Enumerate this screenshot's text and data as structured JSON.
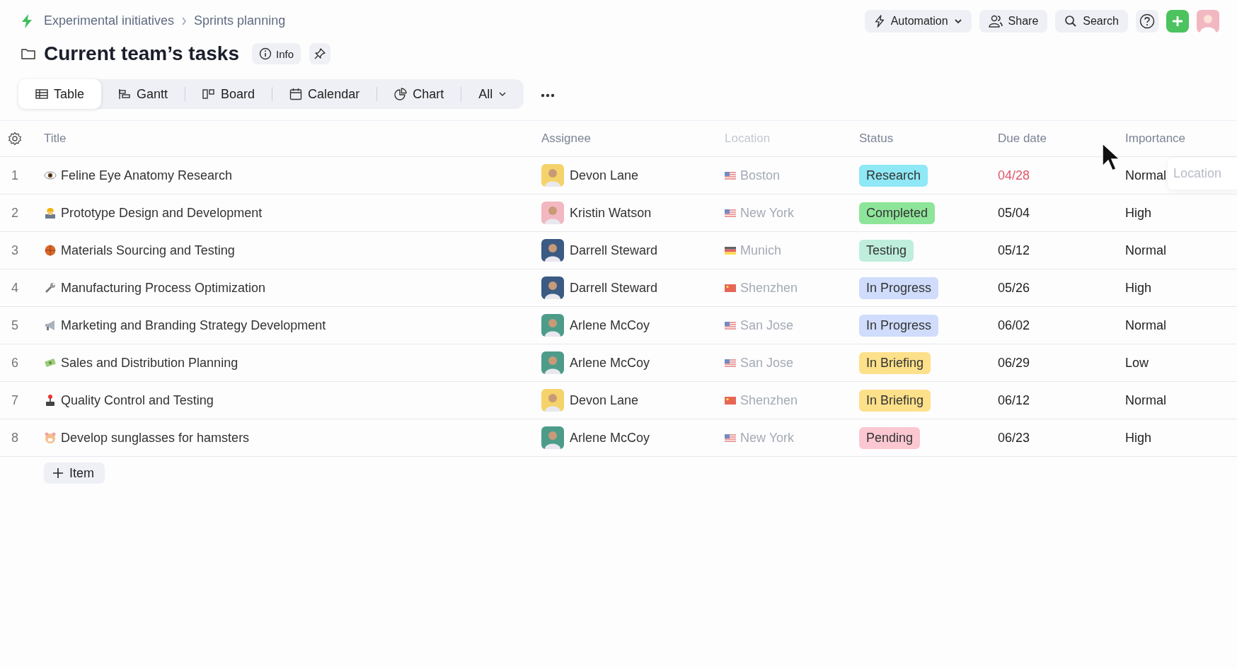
{
  "breadcrumb": {
    "items": [
      "Experimental initiatives",
      "Sprints planning"
    ]
  },
  "page": {
    "title": "Current team’s tasks",
    "info_button": "Info"
  },
  "top_actions": {
    "automation": "Automation",
    "share": "Share",
    "search": "Search"
  },
  "views": [
    {
      "label": "Table",
      "kind": "table",
      "selected": true
    },
    {
      "label": "Gantt",
      "kind": "gantt",
      "selected": false
    },
    {
      "label": "Board",
      "kind": "board",
      "selected": false
    },
    {
      "label": "Calendar",
      "kind": "calendar",
      "selected": false
    },
    {
      "label": "Chart",
      "kind": "chart",
      "selected": false
    },
    {
      "label": "All",
      "kind": "dropdown",
      "selected": false
    }
  ],
  "table": {
    "columns": [
      {
        "label": "Title",
        "dragging": false
      },
      {
        "label": "Assignee",
        "dragging": false
      },
      {
        "label": "Location",
        "dragging": true
      },
      {
        "label": "Status",
        "dragging": false
      },
      {
        "label": "Due date",
        "dragging": false
      },
      {
        "label": "Importance",
        "dragging": false
      }
    ],
    "rows": [
      {
        "number": "1",
        "kind": "eye",
        "title": "Feline Eye Anatomy Research",
        "assignee": {
          "name": "Devon Lane",
          "color": "#f5d36a"
        },
        "location": {
          "name": "Boston",
          "kind": "us"
        },
        "status": {
          "label": "Research",
          "color": "#8ee8f5"
        },
        "due": "04/28",
        "overdue": true,
        "importance": "Normal"
      },
      {
        "number": "2",
        "kind": "worker",
        "title": "Prototype Design and Development",
        "assignee": {
          "name": "Kristin Watson",
          "color": "#f2b7c0"
        },
        "location": {
          "name": "New York",
          "kind": "us"
        },
        "status": {
          "label": "Completed",
          "color": "#8ee59a"
        },
        "due": "05/04",
        "overdue": false,
        "importance": "High"
      },
      {
        "number": "3",
        "kind": "ball",
        "title": "Materials Sourcing and Testing",
        "assignee": {
          "name": "Darrell Steward",
          "color": "#3b5a84"
        },
        "location": {
          "name": "Munich",
          "kind": "de"
        },
        "status": {
          "label": "Testing",
          "color": "#bfeedd"
        },
        "due": "05/12",
        "overdue": false,
        "importance": "Normal"
      },
      {
        "number": "4",
        "kind": "wrench",
        "title": "Manufacturing Process Optimization",
        "assignee": {
          "name": "Darrell Steward",
          "color": "#3b5a84"
        },
        "location": {
          "name": "Shenzhen",
          "kind": "cn"
        },
        "status": {
          "label": "In Progress",
          "color": "#cfdcfb"
        },
        "due": "05/26",
        "overdue": false,
        "importance": "High"
      },
      {
        "number": "5",
        "kind": "megaphone",
        "title": "Marketing and Branding Strategy Development",
        "assignee": {
          "name": "Arlene McCoy",
          "color": "#4d9c8a"
        },
        "location": {
          "name": "San Jose",
          "kind": "us"
        },
        "status": {
          "label": "In Progress",
          "color": "#cfdcfb"
        },
        "due": "06/02",
        "overdue": false,
        "importance": "Normal"
      },
      {
        "number": "6",
        "kind": "money",
        "title": "Sales and Distribution Planning",
        "assignee": {
          "name": "Arlene McCoy",
          "color": "#4d9c8a"
        },
        "location": {
          "name": "San Jose",
          "kind": "us"
        },
        "status": {
          "label": "In Briefing",
          "color": "#fde08a"
        },
        "due": "06/29",
        "overdue": false,
        "importance": "Low"
      },
      {
        "number": "7",
        "kind": "joystick",
        "title": "Quality Control and Testing",
        "assignee": {
          "name": "Devon Lane",
          "color": "#f5d36a"
        },
        "location": {
          "name": "Shenzhen",
          "kind": "cn"
        },
        "status": {
          "label": "In Briefing",
          "color": "#fde08a"
        },
        "due": "06/12",
        "overdue": false,
        "importance": "Normal"
      },
      {
        "number": "8",
        "kind": "hamster",
        "title": "Develop sunglasses for hamsters",
        "assignee": {
          "name": "Arlene McCoy",
          "color": "#4d9c8a"
        },
        "location": {
          "name": "New York",
          "kind": "us"
        },
        "status": {
          "label": "Pending",
          "color": "#fbc8d2"
        },
        "due": "06/23",
        "overdue": false,
        "importance": "High"
      }
    ],
    "add_item": "Item",
    "drag_ghost": "Location"
  }
}
